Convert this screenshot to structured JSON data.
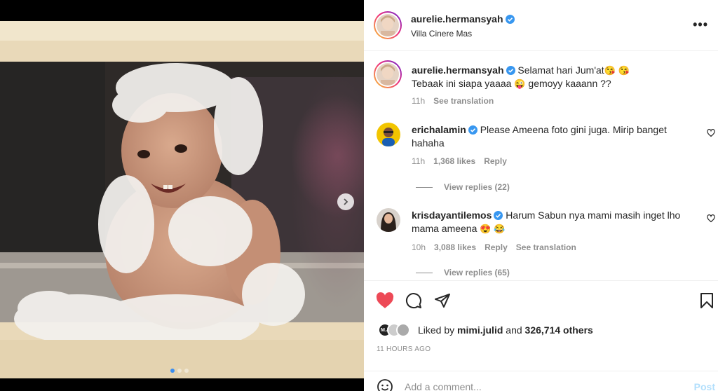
{
  "post": {
    "author": "aurelie.hermansyah",
    "location": "Villa Cinere Mas",
    "more_label": "•••",
    "carousel": {
      "total": 3,
      "active": 1
    }
  },
  "caption": {
    "username": "aurelie.hermansyah",
    "line1": "Selamat hari Jum'at",
    "line1_emoji": "😘 😘",
    "line2": "Tebaak ini siapa yaaaa",
    "line2_emoji": "😜",
    "line2_tail": "gemoyy kaaann ??",
    "time": "11h",
    "see_translation": "See translation"
  },
  "comments": [
    {
      "username": "erichalamin",
      "text": "Please Ameena foto gini juga. Mirip banget hahaha",
      "time": "11h",
      "likes": "1,368 likes",
      "reply": "Reply",
      "view_replies": "View replies (22)"
    },
    {
      "username": "krisdayantilemos",
      "text": "Harum Sabun nya mami masih inget lho mama ameena",
      "emoji": "😍 😂",
      "time": "10h",
      "likes": "3,088 likes",
      "reply": "Reply",
      "see_translation": "See translation",
      "view_replies": "View replies (65)"
    }
  ],
  "likes": {
    "prefix": "Liked by",
    "user": "mimi.julid",
    "and": "and",
    "others": "326,714 others",
    "liker_initials": "M.J"
  },
  "timestamp": "11 HOURS AGO",
  "add_comment": {
    "placeholder": "Add a comment...",
    "post_label": "Post"
  },
  "colors": {
    "like_red": "#ed4956",
    "verified_blue": "#3897f0",
    "muted": "#8e8e8e",
    "post_disabled": "#b2dffc"
  },
  "icons": [
    "verified-icon",
    "more-icon",
    "heart-icon",
    "comment-icon",
    "share-icon",
    "bookmark-icon",
    "smile-icon",
    "chevron-right-icon"
  ]
}
